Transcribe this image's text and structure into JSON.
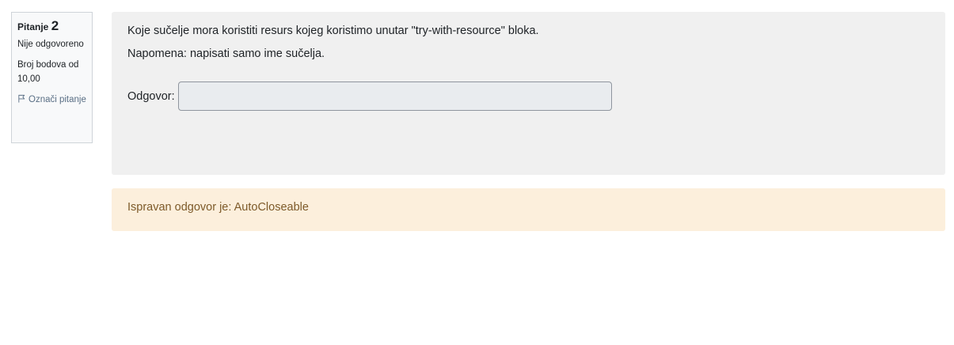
{
  "question_info": {
    "label": "Pitanje",
    "number": "2",
    "state": "Nije odgovoreno",
    "grade": "Broj bodova od 10,00",
    "flag_label": "Označi pitanje"
  },
  "question": {
    "text": "Koje sučelje mora koristiti resurs kojeg koristimo unutar \"try-with-resource\" bloka.",
    "note": "Napomena: napisati samo ime sučelja.",
    "answer_label": "Odgovor:",
    "answer_value": ""
  },
  "feedback": {
    "right_answer": "Ispravan odgovor je: AutoCloseable"
  },
  "colors": {
    "formulation_bg": "#f0f0f0",
    "feedback_bg": "#fcefdc",
    "feedback_text": "#7d5a29",
    "flag_link": "#5a6f85"
  },
  "icons": {
    "flag": "flag-icon"
  }
}
